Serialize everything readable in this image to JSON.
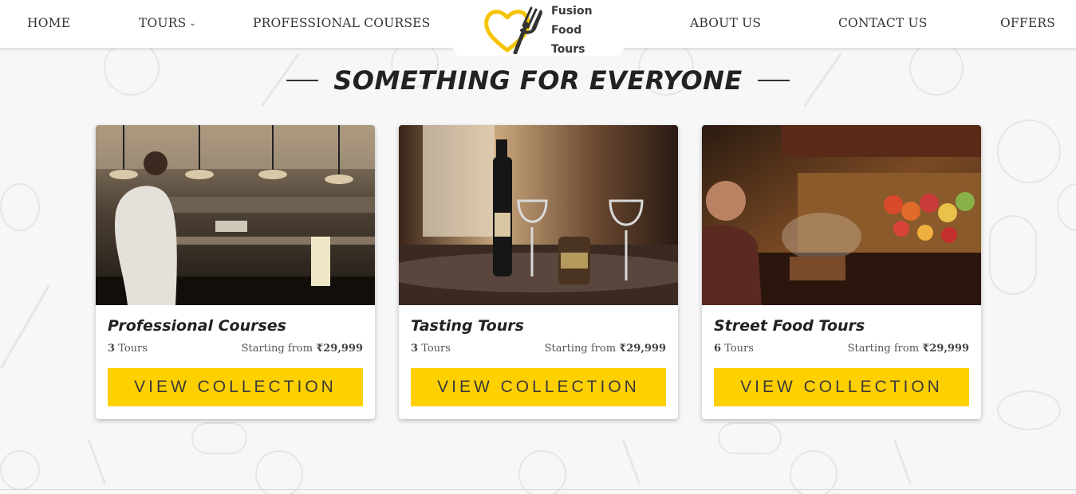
{
  "nav": {
    "home": "HOME",
    "tours": "TOURS",
    "courses": "PROFESSIONAL COURSES",
    "about": "ABOUT US",
    "contact": "CONTACT US",
    "offers": "OFFERS"
  },
  "logo": {
    "line1": "Fusion",
    "line2": "Food",
    "line3": "Tours",
    "heart_color": "#f5c400",
    "fork_color": "#333333"
  },
  "section": {
    "title": "SOMETHING FOR EVERYONE"
  },
  "cards": [
    {
      "title": "Professional Courses",
      "count_num": "3",
      "count_label": "Tours",
      "price_prefix": "Starting from",
      "price": "₹29,999",
      "button": "VIEW COLLECTION",
      "image": "chef-kitchen-photo"
    },
    {
      "title": "Tasting Tours",
      "count_num": "3",
      "count_label": "Tours",
      "price_prefix": "Starting from",
      "price": "₹29,999",
      "button": "VIEW COLLECTION",
      "image": "wine-table-photo"
    },
    {
      "title": "Street Food Tours",
      "count_num": "6",
      "count_label": "Tours",
      "price_prefix": "Starting from",
      "price": "₹29,999",
      "button": "VIEW COLLECTION",
      "image": "market-stall-photo"
    }
  ],
  "colors": {
    "accent": "#ffd000",
    "text_dark": "#222222",
    "background": "#f7f7f7"
  }
}
